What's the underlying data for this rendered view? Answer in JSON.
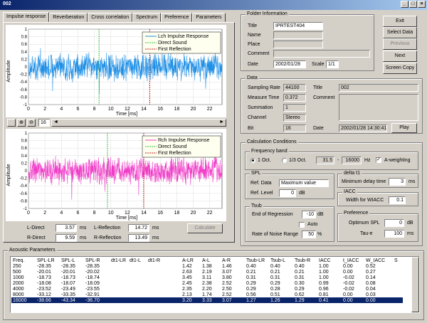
{
  "window": {
    "title": "002"
  },
  "tabs": [
    {
      "label": "Impulse response",
      "active": true
    },
    {
      "label": "Reverberation"
    },
    {
      "label": "Cross correlation"
    },
    {
      "label": "Spectrum"
    },
    {
      "label": "Preference"
    },
    {
      "label": "Parameters"
    }
  ],
  "plot_top": {
    "ylabel": "Amplitude",
    "xlabel": "Time [ms]",
    "yticks": [
      "1",
      "0.8",
      "0.6",
      "0.4",
      "0.2",
      "0",
      "-0.2",
      "-0.4",
      "-0.6",
      "-0.8",
      "-1"
    ],
    "xticks": [
      "0",
      "2",
      "4",
      "6",
      "8",
      "10",
      "12",
      "14",
      "16",
      "18",
      "20",
      "22"
    ],
    "legend": [
      "Lch Impulse Response",
      "Direct Sound",
      "First Reflection"
    ],
    "color": "#1e8fe6"
  },
  "plot_bottom": {
    "ylabel": "Amplitude",
    "xlabel": "Time [ms]",
    "yticks": [
      "1",
      "0.8",
      "0.6",
      "0.4",
      "0.2",
      "0",
      "-0.2",
      "-0.4",
      "-0.6",
      "-0.8",
      "-1"
    ],
    "xticks": [
      "0",
      "2",
      "4",
      "6",
      "8",
      "10",
      "12",
      "14",
      "16",
      "18",
      "20",
      "22"
    ],
    "legend": [
      "Rch Impulse Response",
      "Direct Sound",
      "First Reflection"
    ],
    "color": "#f03cc8"
  },
  "toolbar": {
    "zoom_value": "16"
  },
  "results": {
    "l_direct_label": "L-Direct",
    "l_direct": "3.57",
    "r_direct_label": "R-Direct",
    "r_direct": "9.59",
    "l_refl_label": "L-Reflection",
    "l_refl": "14.72",
    "r_refl_label": "R-Reflection",
    "r_refl": "13.49",
    "unit": "ms",
    "calculate": "Calculate"
  },
  "folder": {
    "title": "Folder Information",
    "title_label": "Title",
    "title_value": "IPRTEST404",
    "name_label": "Name",
    "place_label": "Place",
    "comment_label": "Comment",
    "date_label": "Date",
    "date_value": "2002/01/28",
    "scale_label": "Scale",
    "scale_value": "1/1"
  },
  "buttons": {
    "exit": "Exit",
    "select_data": "Select Data",
    "previous": "Previous",
    "next": "Next",
    "screen_copy": "Screen Copy"
  },
  "data": {
    "title": "Data",
    "sampling_rate_label": "Sampling Rate",
    "sampling_rate": "44100",
    "measure_time_label": "Measure Time",
    "measure_time": "0.372",
    "summation_label": "Summation",
    "summation": "1",
    "channel_label": "Channel",
    "channel": "Stereo",
    "bit_label": "Bit",
    "bit": "16",
    "title_label": "Title",
    "title_value": "002",
    "comment_label": "Comment",
    "date_label": "Date",
    "date_value": "2002/01/28 14:30:41",
    "play": "Play"
  },
  "calc": {
    "title": "Calculation Conditions",
    "freq_band": "Frequency band",
    "oct1": "1 Oct.",
    "oct3": "1/3 Oct.",
    "f_low": "31.5",
    "f_high": "16000",
    "hz": "Hz",
    "aweight": "A-weighting",
    "spl": "SPL",
    "ref_data_label": "Ref. Data",
    "ref_data": "Maximum value",
    "ref_level_label": "Ref. Level",
    "ref_level": "0",
    "db": "dB",
    "deltat1": "delta t1",
    "min_delay_label": "Minimum delay time",
    "min_delay": "3",
    "ms": "ms",
    "iacc": "IACC",
    "width_label": "Width for WIACC",
    "width": "0.1",
    "tsub": "Tsub",
    "end_reg_label": "End of Regression",
    "end_reg": "-10",
    "auto": "Auto",
    "noise_label": "Rate of Noise Range",
    "noise": "50",
    "pct": "%",
    "pref": "Preference",
    "opt_spl_label": "Optimum SPL",
    "opt_spl": "0",
    "taue_label": "Tau-e",
    "taue": "100"
  },
  "acoustic": {
    "title": "Acoustic Parameters",
    "headers": [
      "Freq.",
      "SPL-LR",
      "SPL-L",
      "SPL-R",
      "dt1-LR",
      "dt1-L",
      "dt1-R",
      "A-LR",
      "A-L",
      "A-R",
      "Tsub-LR",
      "Tsub-L",
      "Tsub-R",
      "IACC",
      "t_IACC",
      "W_IACC",
      "S"
    ],
    "rows": [
      [
        "250",
        "-28.35",
        "-28.35",
        "-28.35",
        "",
        "",
        "",
        "1.42",
        "1.38",
        "1.46",
        "0.40",
        "0.40",
        "0.40",
        "1.00",
        "0.00",
        "0.52",
        ""
      ],
      [
        "500",
        "-20.01",
        "-20.01",
        "-20.02",
        "",
        "",
        "",
        "2.63",
        "2.19",
        "3.07",
        "0.21",
        "0.21",
        "0.21",
        "1.00",
        "0.00",
        "0.27",
        ""
      ],
      [
        "1000",
        "-18.73",
        "-18.73",
        "-18.74",
        "",
        "",
        "",
        "3.45",
        "3.11",
        "3.80",
        "0.31",
        "0.31",
        "0.31",
        "1.00",
        "-0.02",
        "0.14",
        ""
      ],
      [
        "2000",
        "-18.08",
        "-18.07",
        "-18.09",
        "",
        "",
        "",
        "2.45",
        "2.38",
        "2.52",
        "0.29",
        "0.29",
        "0.30",
        "0.99",
        "-0.02",
        "0.08",
        ""
      ],
      [
        "4000",
        "-23.52",
        "-23.49",
        "-23.55",
        "",
        "",
        "",
        "2.35",
        "2.20",
        "2.50",
        "0.29",
        "0.28",
        "0.29",
        "0.96",
        "-0.02",
        "0.04",
        ""
      ],
      [
        "8000",
        "-33.12",
        "-33.35",
        "-32.91",
        "",
        "",
        "",
        "2.13",
        "1.74",
        "2.52",
        "0.56",
        "0.51",
        "0.62",
        "0.81",
        "0.00",
        "0.03",
        ""
      ],
      [
        "16000",
        "-38.66",
        "-43.34",
        "-36.70",
        "",
        "",
        "",
        "3.20",
        "3.33",
        "3.07",
        "1.27",
        "1.26",
        "1.29",
        "0.41",
        "0.00",
        "0.00",
        ""
      ]
    ],
    "selected_row": 6
  }
}
